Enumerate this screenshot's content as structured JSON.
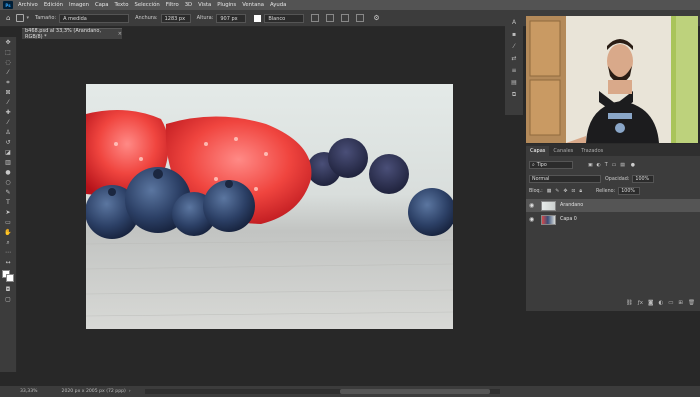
{
  "app": {
    "logo": "Ps"
  },
  "menu": [
    "Archivo",
    "Edición",
    "Imagen",
    "Capa",
    "Texto",
    "Selección",
    "Filtro",
    "3D",
    "Vista",
    "Plugins",
    "Ventana",
    "Ayuda"
  ],
  "options": {
    "size_label": "Tamaño:",
    "size_value": "A medida",
    "width_label": "Anchura:",
    "width_value": "1283 px",
    "height_label": "Altura:",
    "height_value": "907 px",
    "bg_value": "Blanco"
  },
  "document_tab": {
    "title": "b468.psd al 33,3% (Arandano, RGB/8) *",
    "close": "×"
  },
  "status": {
    "zoom": "33,33%",
    "doc_info": "2020 px x 2005 px (72 ppp)"
  },
  "panels": {
    "tabs": [
      "Capas",
      "Canales",
      "Trazados"
    ],
    "filter_label": "Tipo",
    "blend_mode": "Normal",
    "opacity_label": "Opacidad:",
    "opacity_value": "100%",
    "lock_label": "Bloq.:",
    "fill_label": "Relleno:",
    "fill_value": "100%",
    "layers": [
      {
        "name": "Arandano",
        "selected": true
      },
      {
        "name": "Capa 0",
        "selected": false
      }
    ]
  },
  "colors": {
    "accent": "#31a8ff",
    "panel": "#3c3c3c",
    "canvas_bg": "#282828"
  }
}
